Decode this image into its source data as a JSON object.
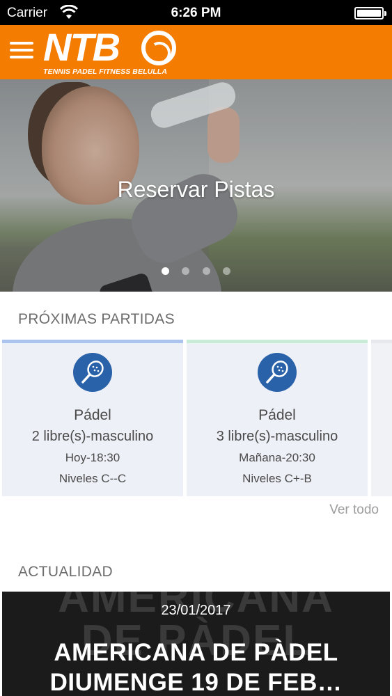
{
  "status_bar": {
    "carrier": "Carrier",
    "time": "6:26 PM",
    "icons": [
      "wifi-icon",
      "battery-icon"
    ]
  },
  "header": {
    "logo_text": "NTB",
    "logo_subtitle": "TENNIS PADEL FITNESS BELULLA",
    "background_color": "#f47c00",
    "menu_icon": "hamburger-menu-icon"
  },
  "hero": {
    "title": "Reservar Pistas",
    "slide_count": 4,
    "active_slide": 1
  },
  "matches": {
    "title": "PRÓXIMAS PARTIDAS",
    "see_all": "Ver todo",
    "items": [
      {
        "sport": "Pádel",
        "slots": "2 libre(s)-masculino",
        "when": "Hoy-18:30",
        "levels": "Niveles C--C",
        "accent_color": "#aac4ef",
        "icon": "padel-racket-icon"
      },
      {
        "sport": "Pádel",
        "slots": "3 libre(s)-masculino",
        "when": "Mañana-20:30",
        "levels": "Niveles C+-B",
        "accent_color": "#c9ecd8",
        "icon": "padel-racket-icon"
      }
    ]
  },
  "news": {
    "title": "ACTUALIDAD",
    "items": [
      {
        "date": "23/01/2017",
        "headline_line1": "AMERICANA DE PÀDEL",
        "headline_line2": "DIUMENGE 19 DE FEB…",
        "background_text_line1": "AMERICANA",
        "background_text_line2": "DE PÀDEL"
      }
    ]
  }
}
